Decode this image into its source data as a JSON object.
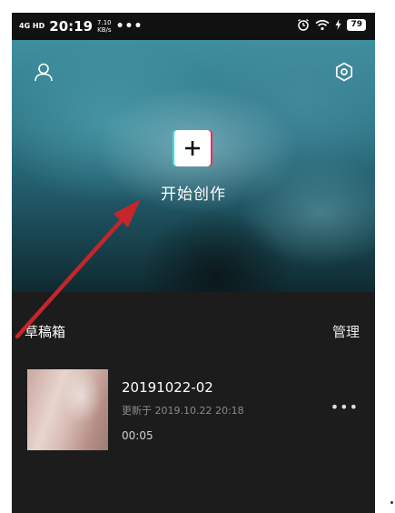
{
  "status_bar": {
    "network": "4G HD",
    "time": "20:19",
    "speed_value": "7.10",
    "speed_unit": "KB/s",
    "more": "•••",
    "battery": "79"
  },
  "hero": {
    "create_label": "开始创作",
    "profile_icon": "user-icon",
    "settings_icon": "gear-icon",
    "plus_icon": "plus-icon"
  },
  "drafts": {
    "title": "草稿箱",
    "manage": "管理",
    "items": [
      {
        "name": "20191022-02",
        "updated": "更新于 2019.10.22 20:18",
        "duration": "00:05",
        "more": "•••"
      }
    ]
  },
  "colors": {
    "background": "#1c1c1c",
    "accent_cyan": "#2ee4e8",
    "accent_red": "#f42b55",
    "arrow": "#c4262c"
  }
}
